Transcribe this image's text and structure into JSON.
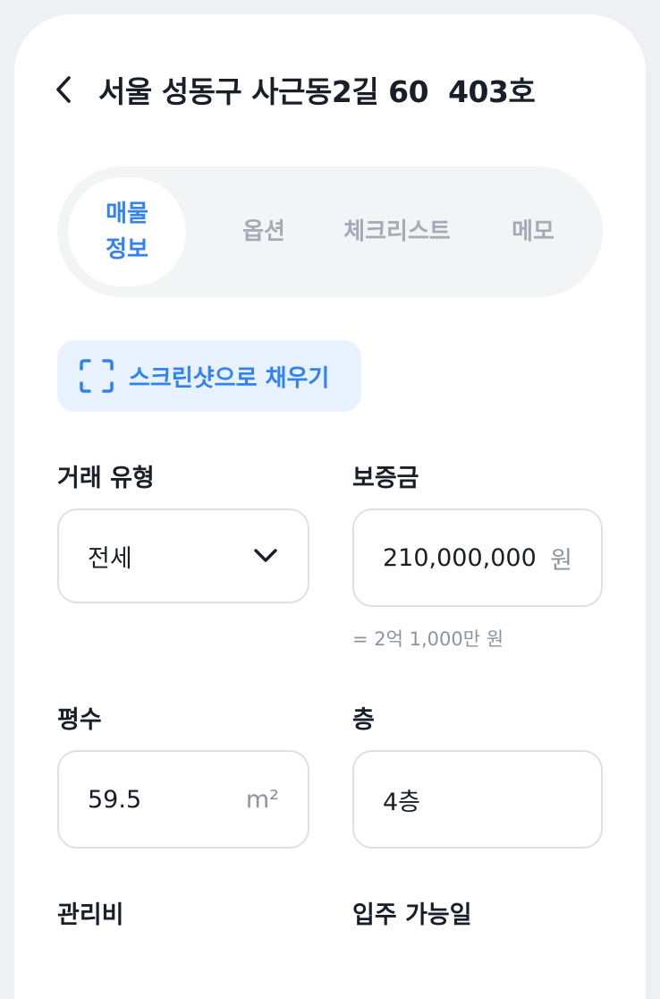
{
  "header": {
    "title": "서울 성동구 사근동2길 60  403호"
  },
  "tabs": [
    {
      "label": "매물정보",
      "active": true
    },
    {
      "label": "옵션",
      "active": false
    },
    {
      "label": "체크리스트",
      "active": false
    },
    {
      "label": "메모",
      "active": false
    }
  ],
  "screenshot_button": {
    "label": "스크린샷으로 채우기"
  },
  "form": {
    "deal_type": {
      "label": "거래 유형",
      "value": "전세"
    },
    "deposit": {
      "label": "보증금",
      "value": "210,000,000",
      "unit": "원",
      "hint": "= 2억 1,000만 원"
    },
    "area": {
      "label": "평수",
      "value": "59.5",
      "unit": "m²"
    },
    "floor": {
      "label": "층",
      "value": "4층"
    },
    "maintenance_fee": {
      "label": "관리비"
    },
    "move_in_date": {
      "label": "입주 가능일"
    }
  },
  "colors": {
    "accent": "#3182f6",
    "accent_bg": "#e8f1fe",
    "tab_bg": "#f2f4f6",
    "muted": "#8b95a1",
    "border": "#dde1e7",
    "text": "#191f28"
  }
}
